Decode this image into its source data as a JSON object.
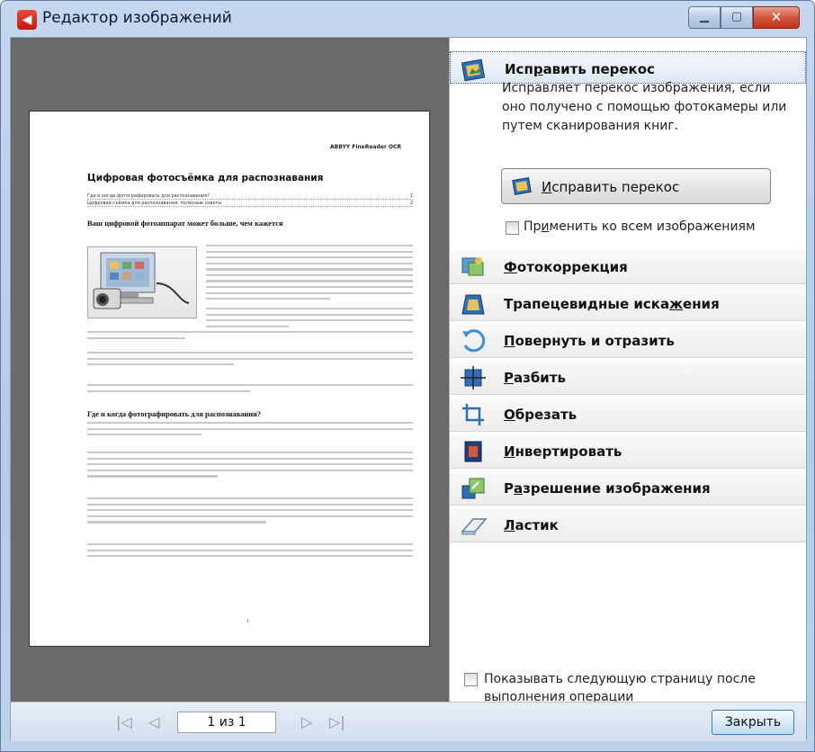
{
  "window": {
    "title": "Редактор изображений",
    "logo_glyph": "◀",
    "controls": {
      "minimize": "▁",
      "maximize": "▢",
      "close": "✕"
    }
  },
  "document": {
    "brand": "ABBYY FineReader OCR",
    "heading": "Цифровая фотосъёмка для распознавания",
    "toc": [
      {
        "text": "Где и когда фотографировать для распознавания?",
        "page": "1"
      },
      {
        "text": "Цифровая съёмка для распознавания: полезные советы",
        "page": "2"
      }
    ],
    "section1_title": "Ваш цифровой фотоаппарат может больше, чем кажется",
    "section2_title": "Где и когда фотографировать для распознавания?",
    "page_number": "1"
  },
  "panel": {
    "active_section": {
      "label_pre": "Исп",
      "label_u": "р",
      "label_post": "авить перекос",
      "description": "Исправляет перекос изображения, если оно получено с помощью фотокамеры или путем сканирования книг.",
      "button_pre": "",
      "button_u": "И",
      "button_post": "справить перекос",
      "apply_all_pre": "Пр",
      "apply_all_u": "и",
      "apply_all_post": "менить ко всем изображениям"
    },
    "sections": [
      {
        "pre": "",
        "u": "Ф",
        "post": "отокоррекция",
        "icon": "photo-correction-icon"
      },
      {
        "pre": "Трапецевидные иска",
        "u": "ж",
        "post": "ения",
        "icon": "trapezoid-icon"
      },
      {
        "pre": "",
        "u": "П",
        "post": "овернуть и отразить",
        "icon": "rotate-icon"
      },
      {
        "pre": "",
        "u": "Р",
        "post": "азбить",
        "icon": "split-icon"
      },
      {
        "pre": "",
        "u": "О",
        "post": "брезать",
        "icon": "crop-icon"
      },
      {
        "pre": "",
        "u": "И",
        "post": "нвертировать",
        "icon": "invert-icon"
      },
      {
        "pre": "Р",
        "u": "а",
        "post": "зрешение изображения",
        "icon": "resolution-icon"
      },
      {
        "pre": "",
        "u": "Л",
        "post": "астик",
        "icon": "eraser-icon"
      }
    ],
    "show_next_page": "Показывать следующую страницу после выполнения операции"
  },
  "footer": {
    "first_glyph": "|◁",
    "prev_glyph": "◁",
    "page_indicator": "1 из 1",
    "next_glyph": "▷",
    "last_glyph": "▷|",
    "close_label": "Закрыть"
  }
}
